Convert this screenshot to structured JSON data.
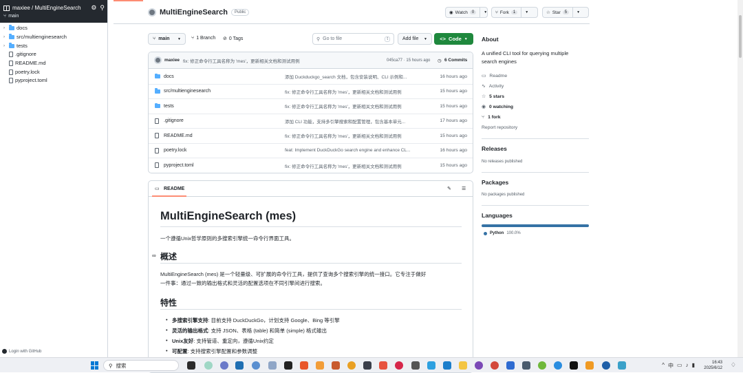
{
  "sidebar": {
    "repo": "maxiee / MultiEngineSearch",
    "branch": "main",
    "tree": [
      {
        "label": "docs",
        "type": "folder"
      },
      {
        "label": "src/multienginesearch",
        "type": "folder"
      },
      {
        "label": "tests",
        "type": "folder"
      },
      {
        "label": ".gitignore",
        "type": "file"
      },
      {
        "label": "README.md",
        "type": "file"
      },
      {
        "label": "poetry.lock",
        "type": "file"
      },
      {
        "label": "pyproject.toml",
        "type": "file"
      }
    ],
    "login": "Login with GitHub"
  },
  "header": {
    "repo_name": "MultiEngineSearch",
    "visibility": "Public",
    "watch": {
      "label": "Watch",
      "count": "0"
    },
    "fork": {
      "label": "Fork",
      "count": "1"
    },
    "star": {
      "label": "Star",
      "count": "5"
    }
  },
  "toolbar": {
    "branch": "main",
    "branches": "1 Branch",
    "tags": "0 Tags",
    "goto_placeholder": "Go to file",
    "goto_key": "t",
    "add_file": "Add file",
    "code": "Code"
  },
  "commit": {
    "author": "maxiee",
    "message": "fix: 修正命令行工具名称为 'mes'，更新相关文档和测试用例",
    "hash_time": "045ca77 · 15 hours ago",
    "count": "6 Commits"
  },
  "files": [
    {
      "name": "docs",
      "type": "folder",
      "message": "添加 Duckduckgo_search 文档，包含安装说明、CLI 示例和...",
      "time": "16 hours ago"
    },
    {
      "name": "src/multienginesearch",
      "type": "folder",
      "message": "fix: 修正命令行工具名称为 'mes'，更新相关文档和测试用例",
      "time": "15 hours ago"
    },
    {
      "name": "tests",
      "type": "folder",
      "message": "fix: 修正命令行工具名称为 'mes'，更新相关文档和测试用例",
      "time": "15 hours ago"
    },
    {
      "name": ".gitignore",
      "type": "file",
      "message": "添加 CLI 功能，支持多引擎搜索和配置管理，包含基本单元...",
      "time": "17 hours ago"
    },
    {
      "name": "README.md",
      "type": "file",
      "message": "fix: 修正命令行工具名称为 'mes'，更新相关文档和测试用例",
      "time": "15 hours ago"
    },
    {
      "name": "poetry.lock",
      "type": "file",
      "message": "feat: Implement DuckDuckGo search engine and enhance CL...",
      "time": "16 hours ago"
    },
    {
      "name": "pyproject.toml",
      "type": "file",
      "message": "fix: 修正命令行工具名称为 'mes'，更新相关文档和测试用例",
      "time": "15 hours ago"
    }
  ],
  "readme": {
    "tab": "README",
    "title": "MultiEngineSearch (mes)",
    "subtitle": "一个遵循Unix哲学原则的多搜索引擎统一命令行界面工具。",
    "h_overview": "概述",
    "overview_1": "MultiEngineSearch (mes) 是一个轻量级、可扩展的命令行工具，提供了查询多个搜索引擎的统一接口。它专注于做好",
    "overview_2": "一件事：通过一致的输出格式和灵活的配置选项在不同引擎间进行搜索。",
    "h_features": "特性",
    "features": [
      {
        "bold": "多搜索引擎支持",
        "text": ": 目前支持 DuckDuckGo，计划支持 Google、Bing 等引擎"
      },
      {
        "bold": "灵活的输出格式",
        "text": ": 支持 JSON、表格 (table) 和简单 (simple) 格式输出"
      },
      {
        "bold": "Unix友好",
        "text": ": 支持管道、重定向，遵循Unix约定"
      },
      {
        "bold": "可配置",
        "text": ": 支持搜索引擎配置和参数调整"
      }
    ]
  },
  "about": {
    "heading": "About",
    "description": "A unified CLI tool for querying multiple search engines",
    "readme": "Readme",
    "activity": "Activity",
    "stars": "5 stars",
    "watching": "0 watching",
    "forks": "1 fork",
    "report": "Report repository",
    "releases_h": "Releases",
    "releases": "No releases published",
    "packages_h": "Packages",
    "packages": "No packages published",
    "languages_h": "Languages",
    "language": "Python",
    "language_pct": "100.0%",
    "language_color": "#3572A5"
  },
  "taskbar": {
    "search": "搜索",
    "time": "16:43",
    "date": "2025/6/12"
  }
}
